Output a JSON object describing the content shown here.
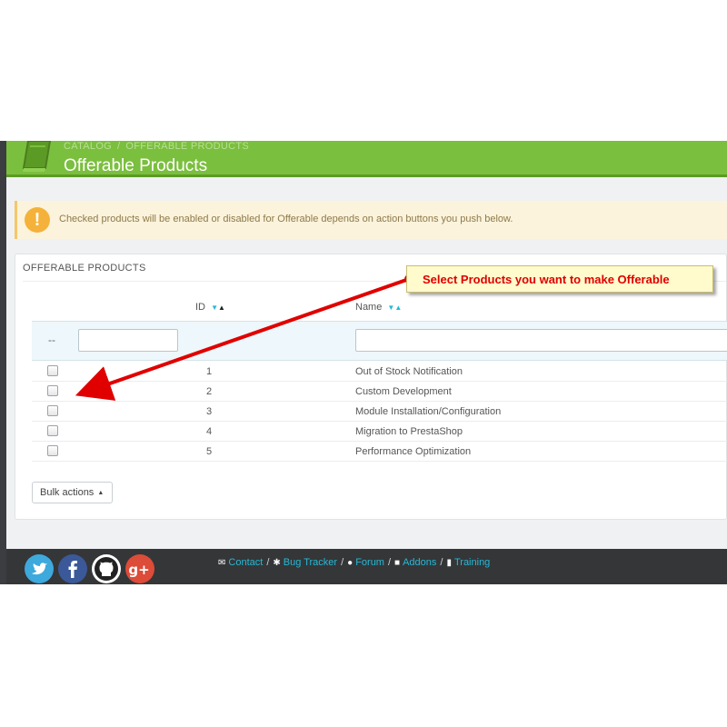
{
  "header": {
    "breadcrumb": [
      "CATALOG",
      "OFFERABLE PRODUCTS"
    ],
    "breadcrumb_sep": "/",
    "title": "Offerable Products",
    "icon": "book-icon",
    "color": "#7bbf3e"
  },
  "alert": {
    "icon": "exclamation-icon",
    "text": "Checked products will be enabled or disabled for Offerable depends on action buttons you push below."
  },
  "panel": {
    "heading": "OFFERABLE PRODUCTS",
    "columns": [
      {
        "label": "ID"
      },
      {
        "label": "Name"
      }
    ],
    "filter_dash": "--",
    "rows": [
      {
        "id": "1",
        "name": "Out of Stock Notification",
        "checked": false
      },
      {
        "id": "2",
        "name": "Custom Development",
        "checked": false
      },
      {
        "id": "3",
        "name": "Module Installation/Configuration",
        "checked": false
      },
      {
        "id": "4",
        "name": "Migration to PrestaShop",
        "checked": false
      },
      {
        "id": "5",
        "name": "Performance Optimization",
        "checked": false
      }
    ],
    "bulk_label": "Bulk actions"
  },
  "callout": {
    "text": "Select Products you want to make Offerable",
    "color": "#e00000"
  },
  "footer": {
    "social": [
      "twitter-icon",
      "facebook-icon",
      "github-icon",
      "google-plus-icon"
    ],
    "links": [
      {
        "icon": "envelope-icon",
        "label": "Contact"
      },
      {
        "icon": "bug-icon",
        "label": "Bug Tracker"
      },
      {
        "icon": "comments-icon",
        "label": "Forum"
      },
      {
        "icon": "puzzle-icon",
        "label": "Addons"
      },
      {
        "icon": "book-icon",
        "label": "Training"
      }
    ],
    "link_color": "#25b9d7"
  }
}
